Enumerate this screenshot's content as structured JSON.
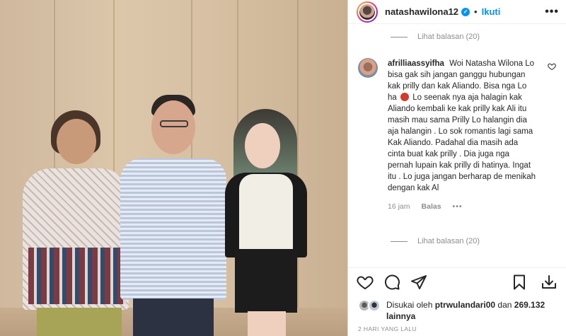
{
  "header": {
    "username": "natashawilona12",
    "verified_mark": "✓",
    "separator": "•",
    "follow_label": "Ikuti",
    "more_label": "•••"
  },
  "replies_top": {
    "label": "Lihat balasan (20)"
  },
  "comment": {
    "username": "afrilliaassyifha",
    "text_before_emoji": "Woi Natasha Wilona Lo bisa gak sih jangan ganggu hubungan kak prilly dan kak Aliando. Bisa nga Lo ha",
    "text_after_emoji": "Lo seenak nya aja halagin kak Aliando kembali ke kak prilly kak Ali itu masih mau sama Prilly Lo halangin dia aja halangin . Lo sok romantis lagi sama Kak Aliando. Padahal dia masih ada cinta buat kak prilly . Dia juga nga pernah lupain kak prilly di hatinya. Ingat itu . Lo juga jangan berharap de menikah dengan kak Al",
    "time": "16 jam",
    "reply_label": "Balas",
    "more_label": "•••"
  },
  "replies_bottom": {
    "label": "Lihat balasan (20)"
  },
  "likes": {
    "prefix": "Disukai oleh",
    "user": "ptrwulandari00",
    "middle": "dan",
    "count": "269.132",
    "suffix": "lainnya"
  },
  "post_time": "2 HARI YANG LALU",
  "icons": {
    "like": "heart-icon",
    "comment": "comment-icon",
    "share": "share-icon",
    "save": "bookmark-icon",
    "download": "download-icon"
  },
  "colors": {
    "accent": "#0095f6",
    "muted": "#8e8e8e",
    "text": "#262626"
  }
}
